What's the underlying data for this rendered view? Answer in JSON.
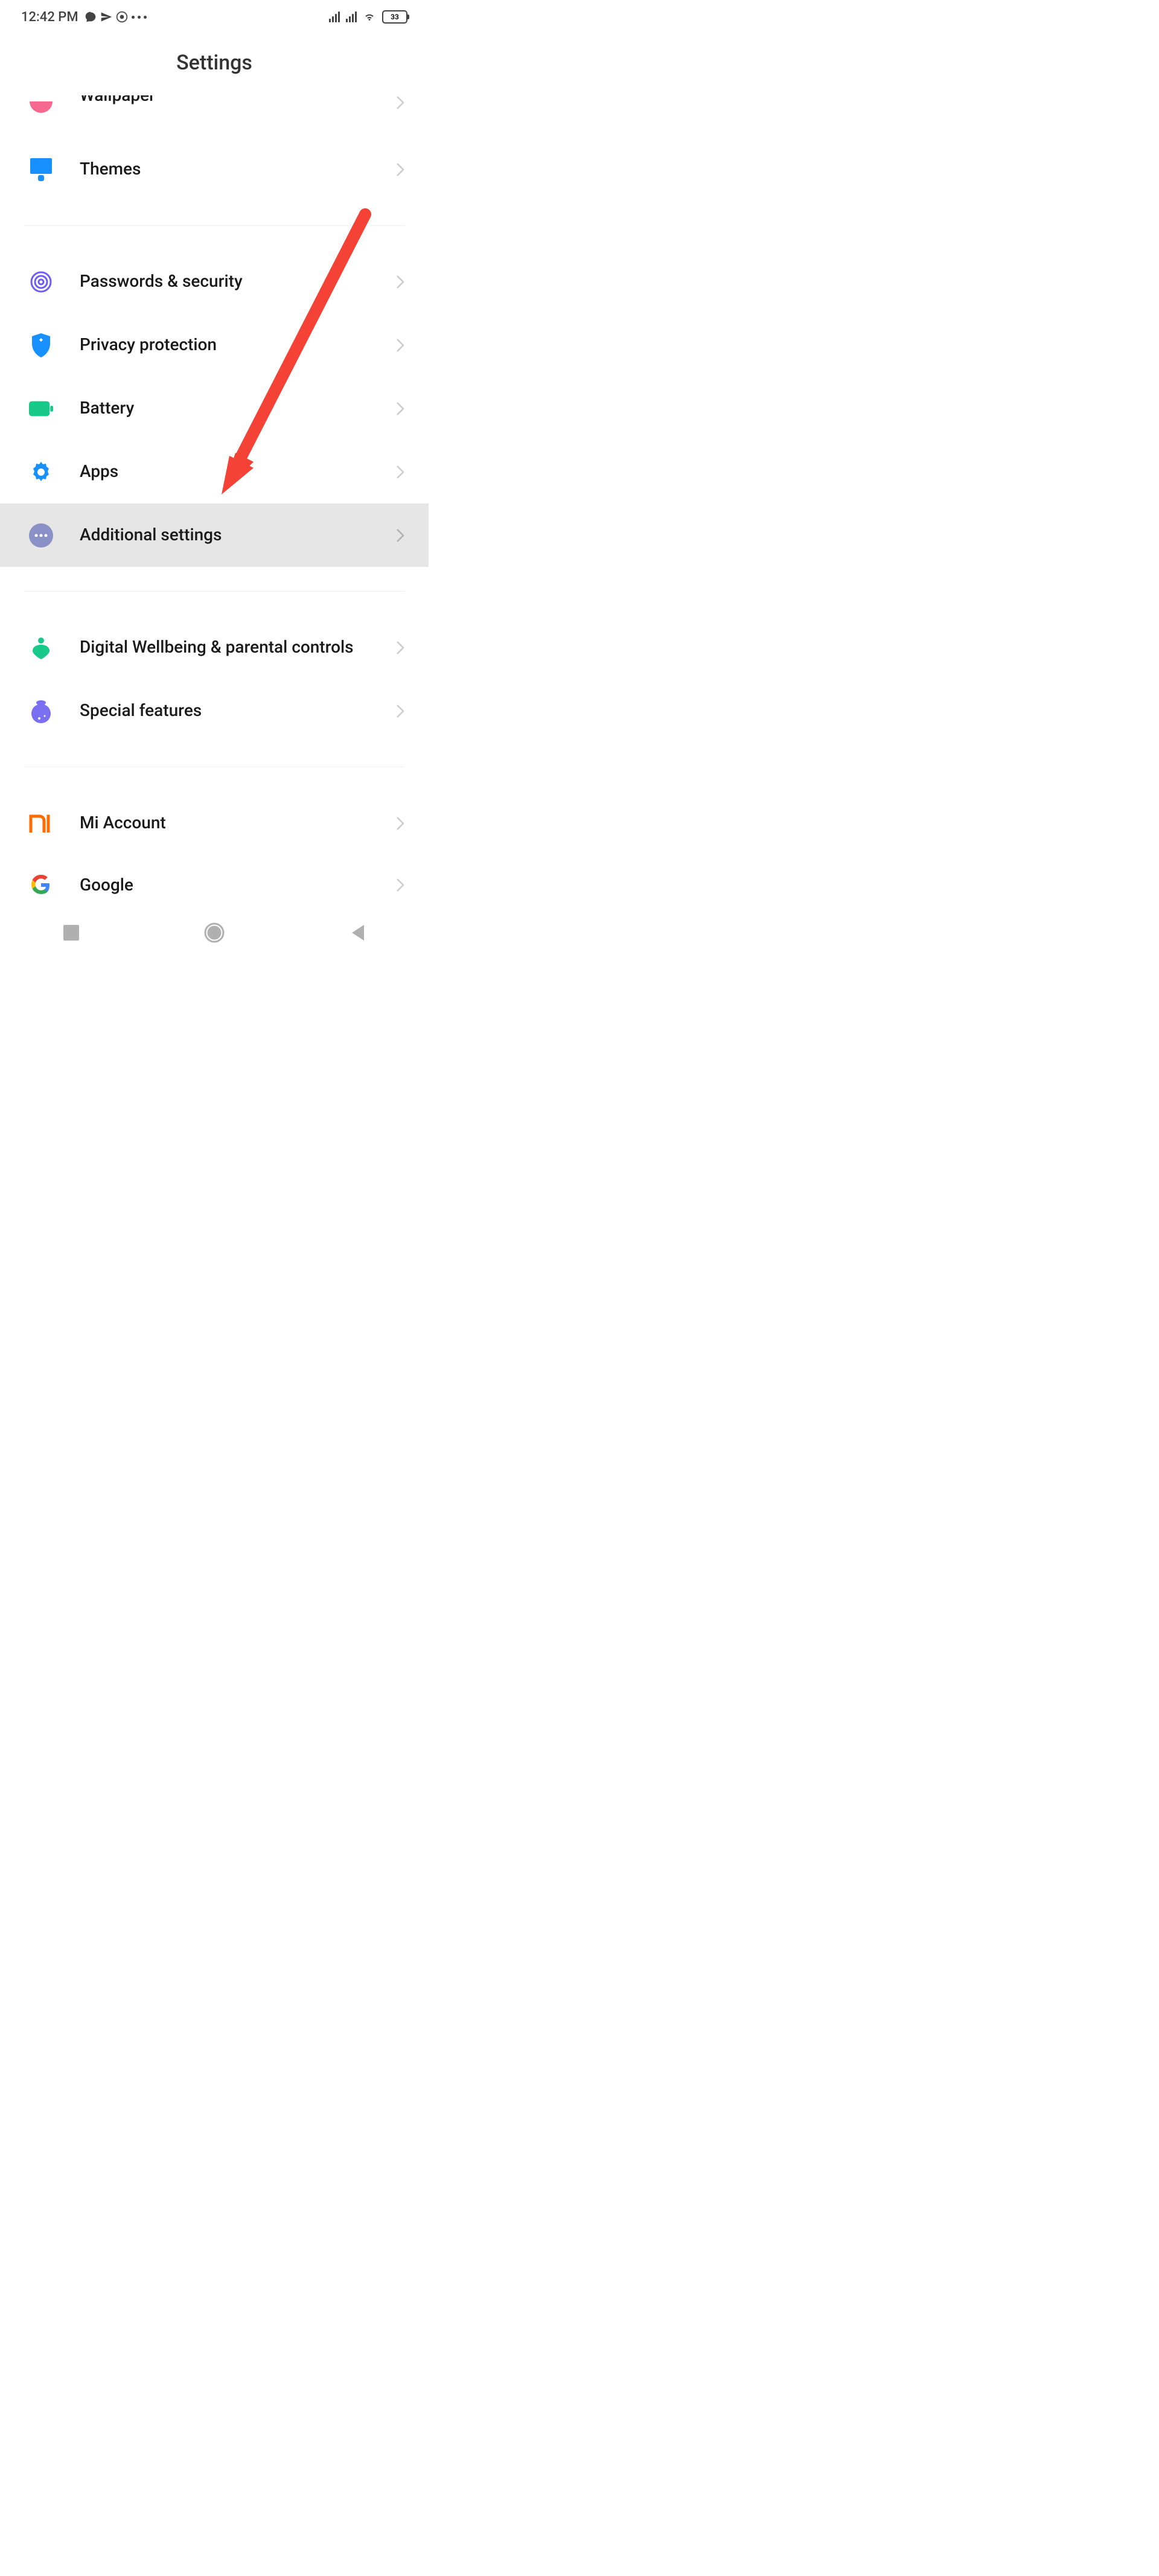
{
  "statusBar": {
    "time": "12:42 PM",
    "batteryLevel": "33"
  },
  "header": {
    "title": "Settings"
  },
  "items": {
    "wallpaper": {
      "label": "Wallpaper"
    },
    "themes": {
      "label": "Themes"
    },
    "passwords": {
      "label": "Passwords & security"
    },
    "privacy": {
      "label": "Privacy protection"
    },
    "battery": {
      "label": "Battery"
    },
    "apps": {
      "label": "Apps"
    },
    "additional": {
      "label": "Additional settings"
    },
    "wellbeing": {
      "label": "Digital Wellbeing & parental controls"
    },
    "special": {
      "label": "Special features"
    },
    "miaccount": {
      "label": "Mi Account"
    },
    "google": {
      "label": "Google"
    }
  },
  "colors": {
    "wallpaper": "#f76890",
    "themes": "#1890ff",
    "passwords": "#6d5ef0",
    "privacy": "#1890ff",
    "battery": "#18c989",
    "apps": "#1890ff",
    "additional": "#8991c7",
    "wellbeing": "#18c989",
    "special": "#7a6ff0",
    "miaccount": "#ff6b00"
  }
}
